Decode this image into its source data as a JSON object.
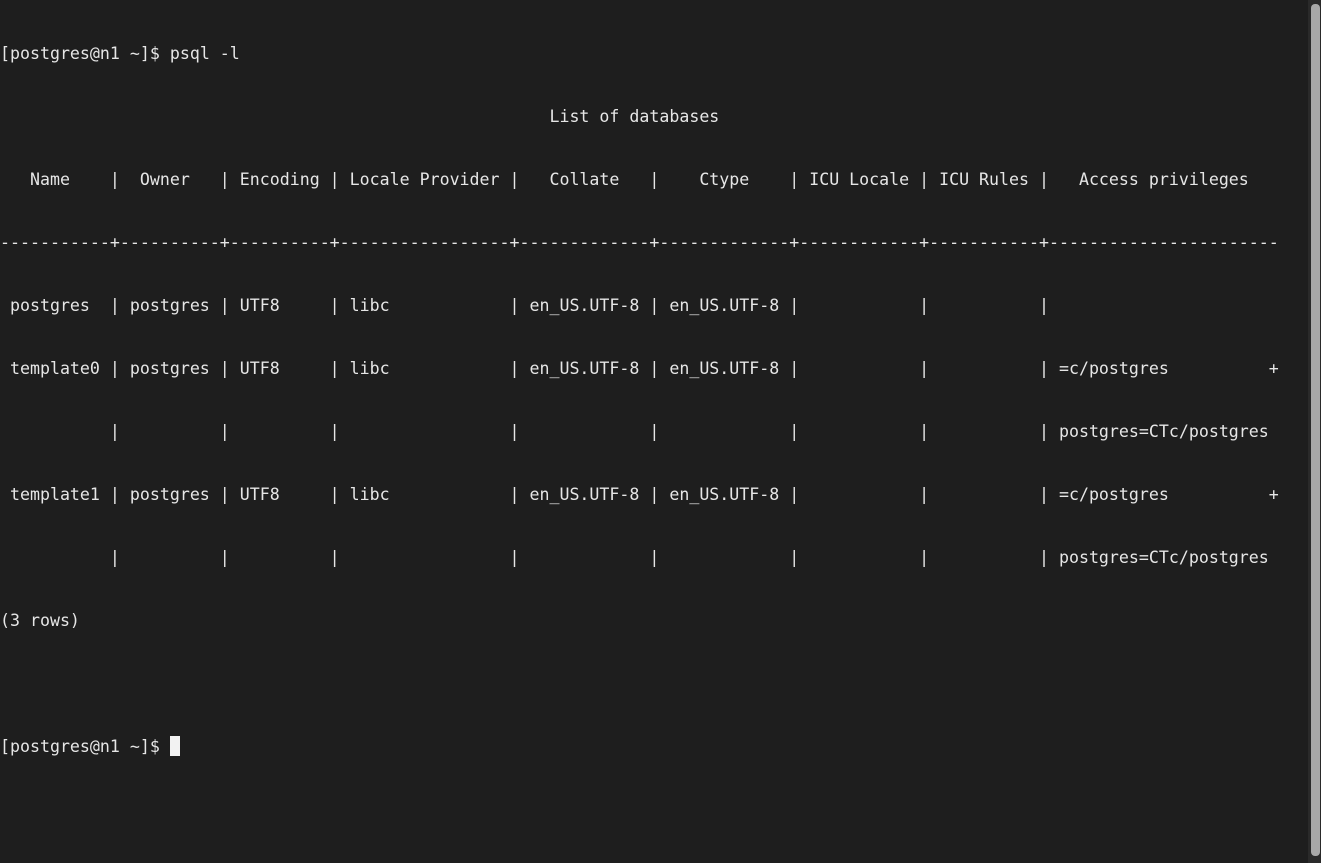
{
  "terminal": {
    "prompt": "[postgres@n1 ~]$ ",
    "command": "psql -l",
    "output_lines": [
      "                                                       List of databases",
      "   Name    |  Owner   | Encoding | Locale Provider |   Collate   |    Ctype    | ICU Locale | ICU Rules |   Access privileges   ",
      "-----------+----------+----------+-----------------+-------------+-------------+------------+-----------+-----------------------",
      " postgres  | postgres | UTF8     | libc            | en_US.UTF-8 | en_US.UTF-8 |            |           | ",
      " template0 | postgres | UTF8     | libc            | en_US.UTF-8 | en_US.UTF-8 |            |           | =c/postgres          +",
      "           |          |          |                 |             |             |            |           | postgres=CTc/postgres",
      " template1 | postgres | UTF8     | libc            | en_US.UTF-8 | en_US.UTF-8 |            |           | =c/postgres          +",
      "           |          |          |                 |             |             |            |           | postgres=CTc/postgres",
      "(3 rows)",
      ""
    ],
    "table": {
      "title": "List of databases",
      "columns": [
        "Name",
        "Owner",
        "Encoding",
        "Locale Provider",
        "Collate",
        "Ctype",
        "ICU Locale",
        "ICU Rules",
        "Access privileges"
      ],
      "rows": [
        [
          "postgres",
          "postgres",
          "UTF8",
          "libc",
          "en_US.UTF-8",
          "en_US.UTF-8",
          "",
          "",
          ""
        ],
        [
          "template0",
          "postgres",
          "UTF8",
          "libc",
          "en_US.UTF-8",
          "en_US.UTF-8",
          "",
          "",
          "=c/postgres + postgres=CTc/postgres"
        ],
        [
          "template1",
          "postgres",
          "UTF8",
          "libc",
          "en_US.UTF-8",
          "en_US.UTF-8",
          "",
          "",
          "=c/postgres + postgres=CTc/postgres"
        ]
      ],
      "row_count_text": "(3 rows)"
    },
    "current_input": ""
  },
  "colors": {
    "background": "#1e1e1e",
    "foreground": "#e6e6e6",
    "cursor": "#f2f2f2",
    "scrollbar_thumb": "#a8a8a8"
  }
}
